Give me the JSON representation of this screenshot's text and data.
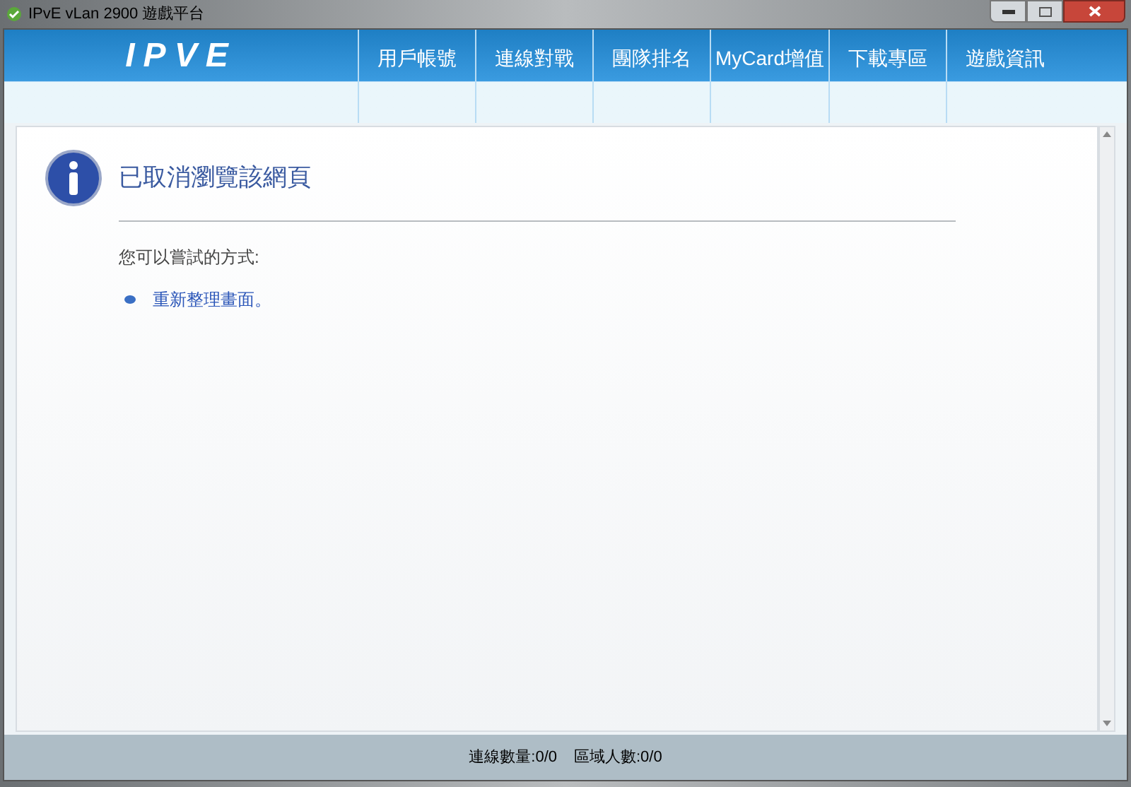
{
  "window": {
    "title": "IPvE vLan 2900 遊戲平台"
  },
  "header": {
    "logo": "IPVE",
    "nav": [
      {
        "label": "用戶帳號"
      },
      {
        "label": "連線對戰"
      },
      {
        "label": "團隊排名"
      },
      {
        "label": "MyCard增值"
      },
      {
        "label": "下載專區"
      },
      {
        "label": "遊戲資訊"
      }
    ]
  },
  "page": {
    "heading": "已取消瀏覽該網頁",
    "subheading": "您可以嘗試的方式:",
    "options": [
      "重新整理畫面。"
    ]
  },
  "status_bar": [
    "連線數量:0/0",
    "區域人數:0/0"
  ]
}
